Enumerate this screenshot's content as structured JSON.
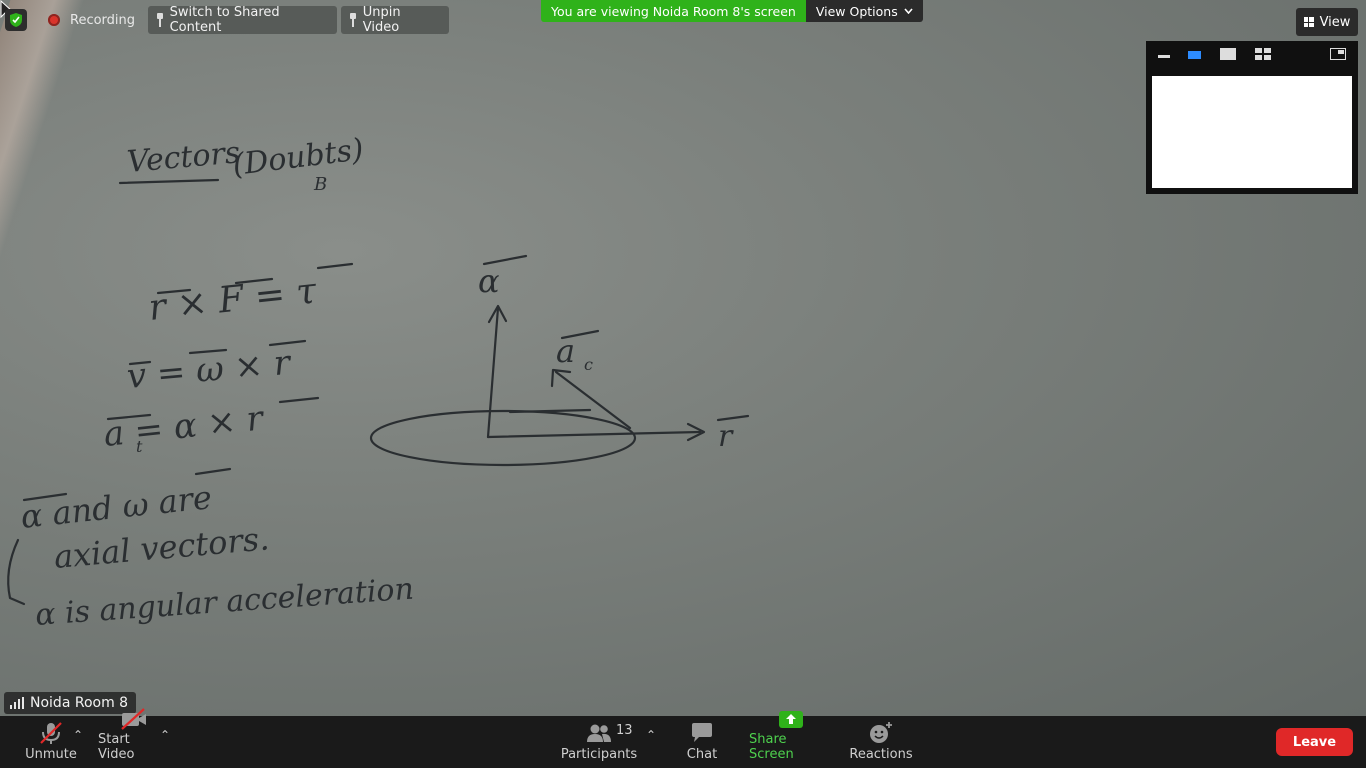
{
  "top": {
    "recording_label": "Recording",
    "switch_shared_label": "Switch to Shared Content",
    "unpin_label": "Unpin Video",
    "viewing_banner": "You are viewing Noida Room 8's screen",
    "view_options_label": "View Options",
    "view_label": "View"
  },
  "video": {
    "participant_name": "Noida Room 8"
  },
  "toolbar": {
    "unmute_label": "Unmute",
    "start_video_label": "Start Video",
    "participants_label": "Participants",
    "participants_count": "13",
    "chat_label": "Chat",
    "share_label": "Share Screen",
    "reactions_label": "Reactions",
    "leave_label": "Leave"
  },
  "colors": {
    "share_green": "#2fb21a",
    "leave_red": "#e02828",
    "recording_red": "#d9342b"
  },
  "icons": [
    "shield-icon",
    "record-dot-icon",
    "pin-icon",
    "chevron-down-icon",
    "grid-icon",
    "signal-icon",
    "mic-muted-icon",
    "video-off-icon",
    "participants-icon",
    "chat-icon",
    "share-screen-icon",
    "reactions-icon",
    "cursor-icon"
  ]
}
